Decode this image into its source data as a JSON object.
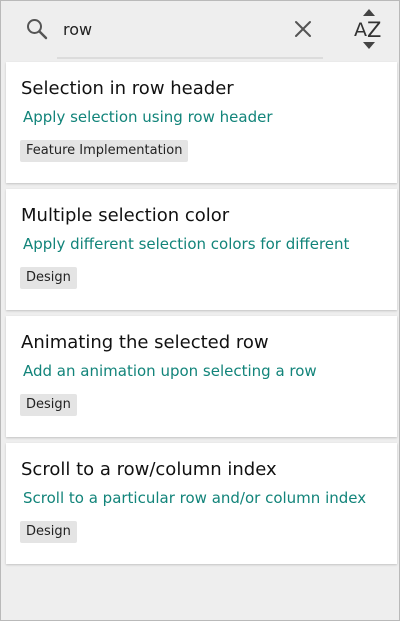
{
  "search": {
    "value": "row",
    "icon": "search-icon",
    "clear_icon": "close-icon",
    "sort_icon": "sort-alpha-icon",
    "sort_letter_a": "A",
    "sort_letter_z": "Z"
  },
  "colors": {
    "subtitle": "#12847a",
    "tag_bg": "#e4e4e4",
    "background": "#eeeeee"
  },
  "cards": [
    {
      "title": "Selection in row header",
      "subtitle": "Apply selection using row header",
      "tag": "Feature Implementation"
    },
    {
      "title": "Multiple selection color",
      "subtitle": "Apply different selection colors for different",
      "tag": "Design"
    },
    {
      "title": "Animating the selected row",
      "subtitle": "Add an animation upon selecting a row",
      "tag": "Design"
    },
    {
      "title": "Scroll to a row/column index",
      "subtitle": "Scroll to a particular row and/or column index",
      "tag": "Design"
    }
  ]
}
